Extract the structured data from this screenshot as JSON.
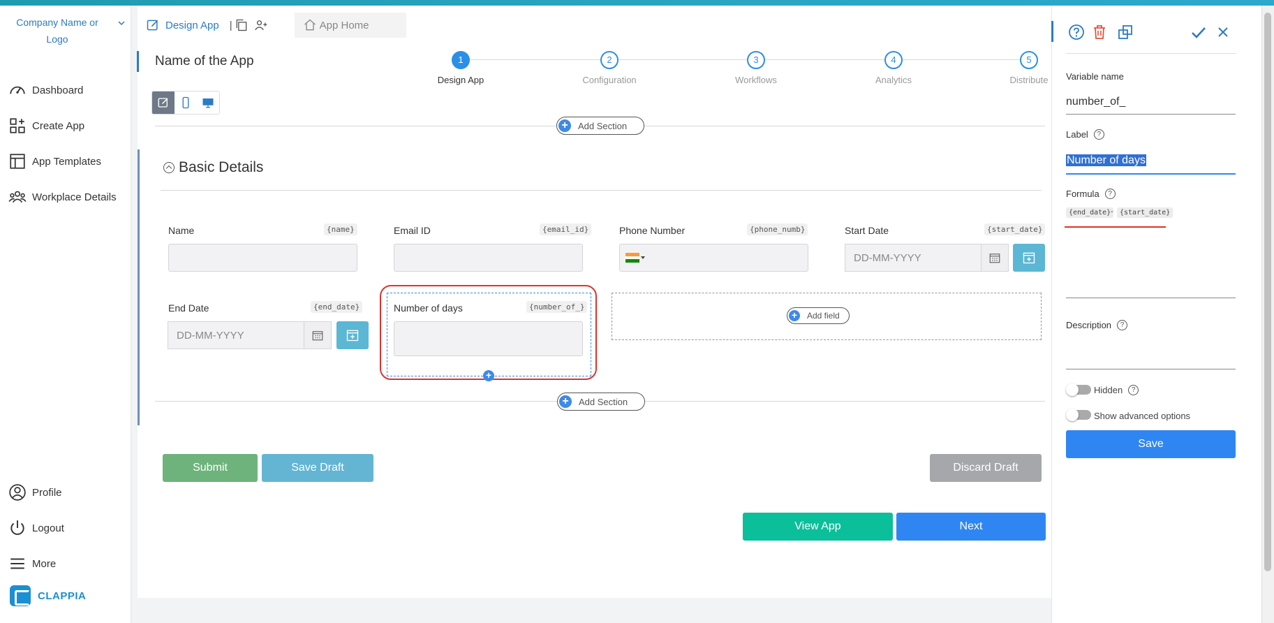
{
  "sidebar": {
    "company": "Company Name or Logo",
    "items": [
      {
        "label": "Dashboard",
        "icon": "speedometer-icon"
      },
      {
        "label": "Create App",
        "icon": "create-app-icon"
      },
      {
        "label": "App Templates",
        "icon": "templates-icon"
      },
      {
        "label": "Workplace Details",
        "icon": "team-icon"
      }
    ],
    "bottom_items": [
      {
        "label": "Profile",
        "icon": "user-icon"
      },
      {
        "label": "Logout",
        "icon": "power-icon"
      },
      {
        "label": "More",
        "icon": "menu-icon"
      }
    ],
    "logo_text": "CLAPPIA"
  },
  "tabs": {
    "design": "Design App",
    "home": "App Home"
  },
  "app_name": "Name of the App",
  "steps": [
    {
      "num": "1",
      "label": "Design App",
      "active": true
    },
    {
      "num": "2",
      "label": "Configuration",
      "active": false
    },
    {
      "num": "3",
      "label": "Workflows",
      "active": false
    },
    {
      "num": "4",
      "label": "Analytics",
      "active": false
    },
    {
      "num": "5",
      "label": "Distribute",
      "active": false
    }
  ],
  "add_section": "Add Section",
  "section_title": "Basic Details",
  "fields": {
    "name": {
      "label": "Name",
      "tag": "{name}"
    },
    "email": {
      "label": "Email ID",
      "tag": "{email_id}"
    },
    "phone": {
      "label": "Phone Number",
      "tag": "{phone_numb}"
    },
    "start_date": {
      "label": "Start Date",
      "tag": "{start_date}",
      "placeholder": "DD-MM-YYYY"
    },
    "end_date": {
      "label": "End Date",
      "tag": "{end_date}",
      "placeholder": "DD-MM-YYYY"
    },
    "number_of_days": {
      "label": "Number of days",
      "tag": "{number_of_}"
    }
  },
  "add_field": "Add field",
  "buttons": {
    "submit": "Submit",
    "save_draft": "Save Draft",
    "discard_draft": "Discard Draft",
    "view_app": "View App",
    "next": "Next"
  },
  "right_panel": {
    "variable_name_label": "Variable name",
    "variable_name_value": "number_of_",
    "label_label": "Label",
    "label_value": "Number of days",
    "formula_label": "Formula",
    "formula_left": "{end_date}",
    "formula_op": "-",
    "formula_right": "{start_date}",
    "description_label": "Description",
    "hidden_label": "Hidden",
    "advanced_label": "Show advanced options",
    "save": "Save"
  },
  "colors": {
    "accent": "#2b8fe6",
    "submit": "#6db37b",
    "save_draft": "#63b5d3",
    "discard": "#a5a7ab",
    "view_app": "#0abf9a",
    "next": "#2f86f2",
    "highlight": "#e2312b"
  }
}
